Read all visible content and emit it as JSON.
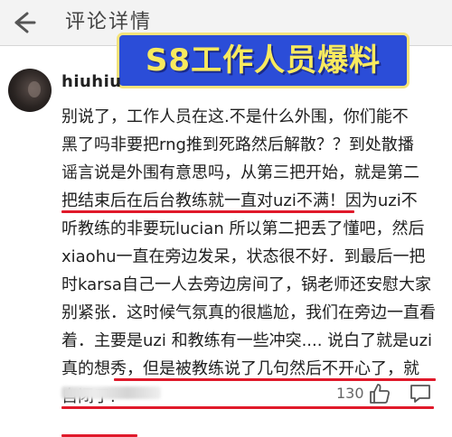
{
  "header": {
    "title": "评论详情",
    "back_icon": "back-arrow-icon"
  },
  "banner": {
    "text": "S8工作人员爆料",
    "bg_color": "#2b4dd8",
    "text_color": "#f8ea5e"
  },
  "comment": {
    "username": "hiuhiu",
    "lines": [
      "别说了，工作人员在这.不是什么外围，你们能不",
      "黑了吗非要把rng推到死路然后解散？？到处散播",
      "谣言说是外围有意思吗，从第三把开始，就是第二",
      "把结束后在后台教练就一直对uzi不满！因为uzi不",
      "听教练的非要玩lucian 所以第二把丢了懂吧，然后",
      "xiaohu一直在旁边发呆，状态很不好．到最后一把",
      "时karsa自己一人去旁边房间了，锅老师还安慰大家",
      "别紧张．这时候气氛真的很尴尬，我们在旁边一直看",
      "着．主要是uzi 和教练有一些冲突.... 说白了就是uzi",
      "真的想秀，但是被教练说了几句然后不开心了，就",
      "自闭了."
    ],
    "highlight_color": "#e0192a"
  },
  "footer": {
    "like_count": "130",
    "like_icon": "thumbs-up-icon",
    "reply_icon": "comment-bubble-icon"
  }
}
